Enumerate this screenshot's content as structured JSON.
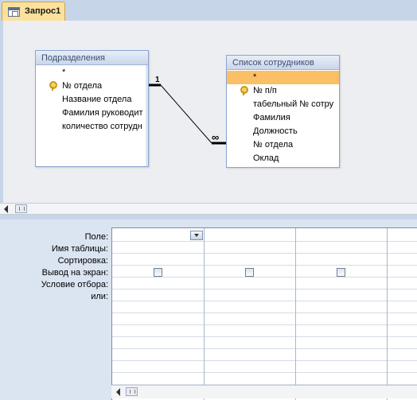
{
  "tab": {
    "label": "Запрос1",
    "icon": "query-icon"
  },
  "tables": [
    {
      "title": "Подразделения",
      "fields": [
        {
          "label": "*",
          "key": false
        },
        {
          "label": "№ отдела",
          "key": true
        },
        {
          "label": "Название отдела",
          "key": false
        },
        {
          "label": "Фамилия руководит",
          "key": false
        },
        {
          "label": "количество сотрудн",
          "key": false
        }
      ]
    },
    {
      "title": "Список сотрудников",
      "fields": [
        {
          "label": "*",
          "key": false,
          "selected": true
        },
        {
          "label": "№ п/п",
          "key": true
        },
        {
          "label": "табельный № сотру",
          "key": false
        },
        {
          "label": "Фамилия",
          "key": false
        },
        {
          "label": "Должность",
          "key": false
        },
        {
          "label": "№ отдела",
          "key": false
        },
        {
          "label": "Оклад",
          "key": false
        }
      ]
    }
  ],
  "relationship": {
    "one_side": "1",
    "many_side": "∞"
  },
  "qbe": {
    "row_labels": [
      "Поле:",
      "Имя таблицы:",
      "Сортировка:",
      "Вывод на экран:",
      "Условие отбора:",
      "или:"
    ]
  },
  "colors": {
    "tab_active": "#fbe19c",
    "selected_field": "#fbbf66",
    "table_border": "#8aa6d1"
  }
}
